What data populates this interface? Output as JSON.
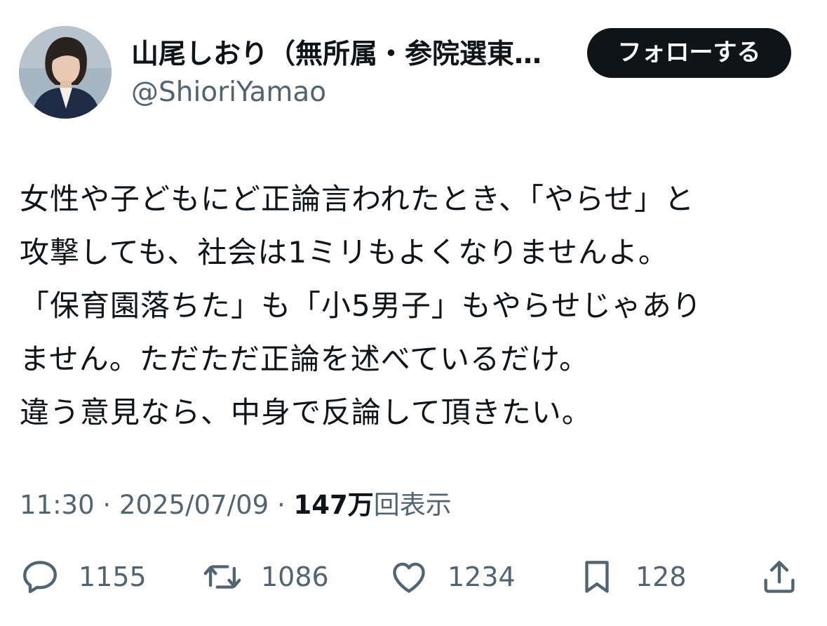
{
  "author": {
    "display_name": "山尾しおり（無所属・参院選東…",
    "handle": "@ShioriYamao",
    "avatar_icon": "profile-photo"
  },
  "follow_button": {
    "label": "フォローする"
  },
  "tweet": {
    "lines": [
      "女性や子どもにど正論言われたとき、「やらせ」と",
      "攻撃しても、社会は1ミリもよくなりませんよ。",
      "「保育園落ちた」も「小5男子」もやらせじゃあり",
      "ません。ただただ正論を述べているだけ。",
      "違う意見なら、中身で反論して頂きたい。"
    ]
  },
  "meta": {
    "time": "11:30",
    "separator": " · ",
    "date": "2025/07/09",
    "views_count": "147万",
    "views_label": "回表示"
  },
  "actions": {
    "reply": {
      "icon": "reply-icon",
      "count": "1155"
    },
    "repost": {
      "icon": "repost-icon",
      "count": "1086"
    },
    "like": {
      "icon": "heart-icon",
      "count": "1234"
    },
    "bookmark": {
      "icon": "bookmark-icon",
      "count": "128"
    },
    "share": {
      "icon": "share-icon"
    }
  },
  "colors": {
    "text": "#0f1419",
    "secondary": "#536471",
    "button_bg": "#0f1419",
    "button_text": "#ffffff",
    "background": "#ffffff"
  }
}
